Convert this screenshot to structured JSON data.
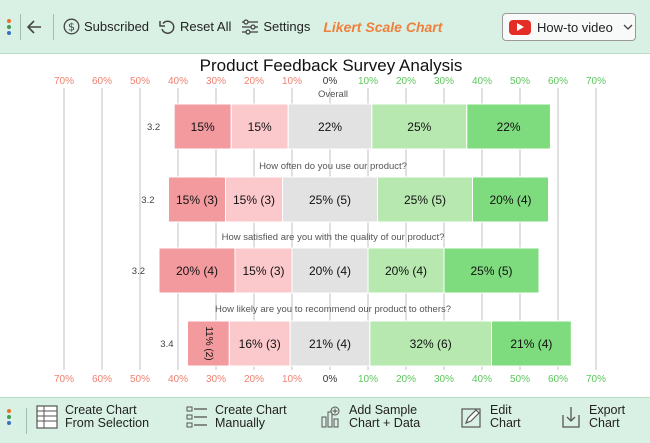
{
  "toolbar": {
    "subscribed_label": "Subscribed",
    "reset_label": "Reset All",
    "settings_label": "Settings",
    "chart_name": "Likert Scale Chart",
    "video_label": "How-to video"
  },
  "bottom_toolbar": {
    "create_selection_l1": "Create Chart",
    "create_selection_l2": "From Selection",
    "create_manual_l1": "Create Chart",
    "create_manual_l2": "Manually",
    "add_sample_l1": "Add Sample",
    "add_sample_l2": "Chart + Data",
    "edit_l1": "Edit",
    "edit_l2": "Chart",
    "export_l1": "Export",
    "export_l2": "Chart"
  },
  "colors": {
    "toolbar_bg": "#d9f1e4",
    "accent_orange": "#f07f3c",
    "strongly_disagree": "#f39a9f",
    "disagree": "#fbc9cc",
    "neutral": "#e2e2e2",
    "agree": "#b6e8b0",
    "strongly_agree": "#7edb7e",
    "negative_tick": "#f08070",
    "positive_tick": "#5cc75c"
  },
  "chart_data": {
    "type": "bar",
    "subtype": "diverging-stacked-likert",
    "title": "Product Feedback Survey Analysis",
    "xlim": [
      -70,
      70
    ],
    "x_ticks": [
      -70,
      -60,
      -50,
      -40,
      -30,
      -20,
      -10,
      0,
      10,
      20,
      30,
      40,
      50,
      60,
      70
    ],
    "x_tick_labels": [
      "70%",
      "60%",
      "50%",
      "40%",
      "30%",
      "20%",
      "10%",
      "0%",
      "10%",
      "20%",
      "30%",
      "40%",
      "50%",
      "60%",
      "70%"
    ],
    "grid": true,
    "categories": [
      "Overall",
      "How often do you use our product?",
      "How satisfied are you with the quality of our product?",
      "How likely are you to recommend our product to others?"
    ],
    "scores": [
      "3.2",
      "3.2",
      "3.2",
      "3.4"
    ],
    "series": [
      {
        "values": [
          15,
          15,
          20,
          11
        ],
        "labels": [
          "15%",
          "15% (3)",
          "20% (4)",
          "11% (2)"
        ]
      },
      {
        "values": [
          15,
          15,
          15,
          16
        ],
        "labels": [
          "15%",
          "15% (3)",
          "15% (3)",
          "16% (3)"
        ]
      },
      {
        "values": [
          22,
          25,
          20,
          21
        ],
        "labels": [
          "22%",
          "25% (5)",
          "20% (4)",
          "21% (4)"
        ]
      },
      {
        "values": [
          25,
          25,
          20,
          32
        ],
        "labels": [
          "25%",
          "25% (5)",
          "20% (4)",
          "32% (6)"
        ]
      },
      {
        "values": [
          22,
          20,
          25,
          21
        ],
        "labels": [
          "22%",
          "20% (4)",
          "25% (5)",
          "21% (4)"
        ]
      }
    ]
  }
}
